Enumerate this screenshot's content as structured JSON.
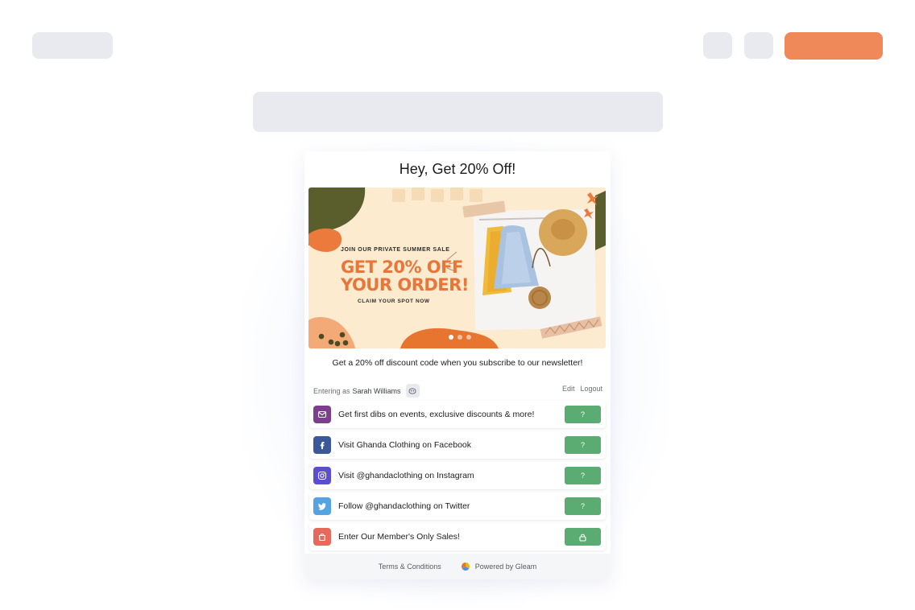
{
  "widget": {
    "title": "Hey, Get 20% Off!",
    "banner": {
      "subheading": "JOIN OUR PRIVATE SUMMER SALE",
      "headline_line1": "GET 20% OFF",
      "headline_line2": "YOUR ORDER!",
      "footer": "CLAIM YOUR SPOT NOW",
      "slides_total": 3,
      "slide_active": 1
    },
    "description": "Get a 20% off discount code when you subscribe to our newsletter!",
    "user": {
      "entering_prefix": "Entering as",
      "name": "Sarah Williams",
      "edit_label": "Edit",
      "logout_label": "Logout"
    },
    "entries": [
      {
        "label": "Get first dibs on events, exclusive discounts & more!",
        "icon": "mail-icon",
        "color": "#7b3f8e",
        "action": "?"
      },
      {
        "label": "Visit Ghanda Clothing on Facebook",
        "icon": "facebook-icon",
        "color": "#3b5998",
        "action": "?"
      },
      {
        "label": "Visit @ghandaclothing on Instagram",
        "icon": "instagram-icon",
        "color": "#5b4fcf",
        "action": "?"
      },
      {
        "label": "Follow @ghandaclothing on Twitter",
        "icon": "twitter-icon",
        "color": "#55a3e0",
        "action": "?"
      },
      {
        "label": "Enter Our Member's Only Sales!",
        "icon": "shopping-bag-icon",
        "color": "#e56a5c",
        "action": "lock-icon"
      }
    ],
    "footer": {
      "terms": "Terms & Conditions",
      "powered_by": "Powered by Gleam"
    }
  },
  "colors": {
    "accent": "#f0895a",
    "success": "#5aac73",
    "placeholder": "#e9eaef"
  }
}
